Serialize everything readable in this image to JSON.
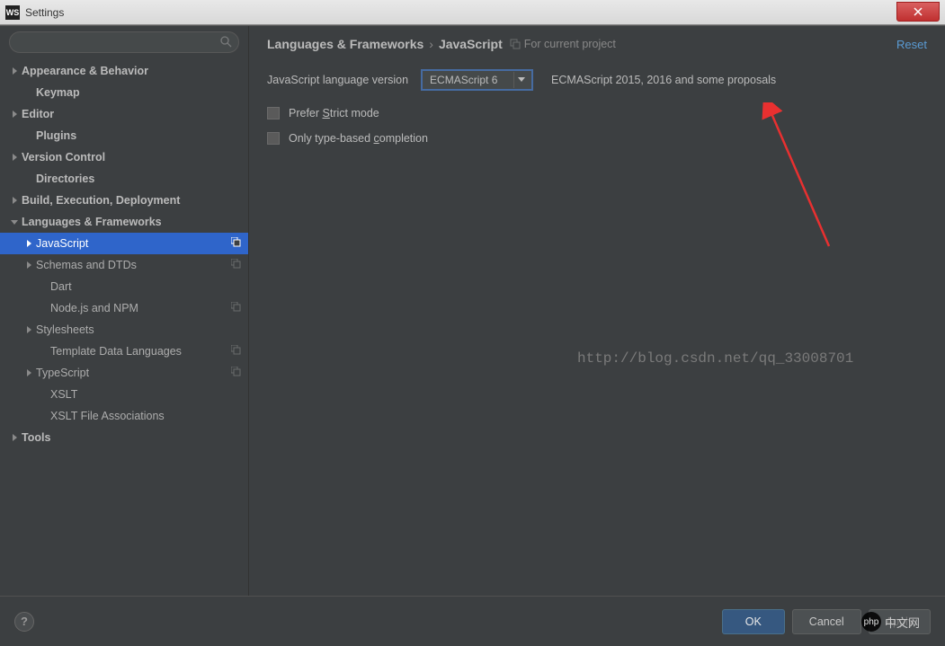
{
  "window": {
    "icon": "WS",
    "title": "Settings"
  },
  "search": {
    "placeholder": ""
  },
  "sidebar": [
    {
      "label": "Appearance & Behavior",
      "bold": true,
      "arrow": "right",
      "indent": 0
    },
    {
      "label": "Keymap",
      "bold": true,
      "arrow": "none",
      "indent": 0
    },
    {
      "label": "Editor",
      "bold": true,
      "arrow": "right",
      "indent": 0
    },
    {
      "label": "Plugins",
      "bold": true,
      "arrow": "none",
      "indent": 0
    },
    {
      "label": "Version Control",
      "bold": true,
      "arrow": "right",
      "indent": 0
    },
    {
      "label": "Directories",
      "bold": true,
      "arrow": "none",
      "indent": 0
    },
    {
      "label": "Build, Execution, Deployment",
      "bold": true,
      "arrow": "right",
      "indent": 0
    },
    {
      "label": "Languages & Frameworks",
      "bold": true,
      "arrow": "down",
      "indent": 0
    },
    {
      "label": "JavaScript",
      "bold": false,
      "arrow": "right",
      "indent": 1,
      "selected": true,
      "copy": true
    },
    {
      "label": "Schemas and DTDs",
      "bold": false,
      "arrow": "right",
      "indent": 1,
      "copy": true
    },
    {
      "label": "Dart",
      "bold": false,
      "arrow": "none",
      "indent": 1
    },
    {
      "label": "Node.js and NPM",
      "bold": false,
      "arrow": "none",
      "indent": 1,
      "copy": true
    },
    {
      "label": "Stylesheets",
      "bold": false,
      "arrow": "right",
      "indent": 1
    },
    {
      "label": "Template Data Languages",
      "bold": false,
      "arrow": "none",
      "indent": 1,
      "copy": true
    },
    {
      "label": "TypeScript",
      "bold": false,
      "arrow": "right",
      "indent": 1,
      "copy": true
    },
    {
      "label": "XSLT",
      "bold": false,
      "arrow": "none",
      "indent": 1
    },
    {
      "label": "XSLT File Associations",
      "bold": false,
      "arrow": "none",
      "indent": 1
    },
    {
      "label": "Tools",
      "bold": true,
      "arrow": "right",
      "indent": 0
    }
  ],
  "breadcrumb": {
    "seg1": "Languages & Frameworks",
    "seg2": "JavaScript",
    "scope": "For current project",
    "reset": "Reset"
  },
  "form": {
    "lang_label": "JavaScript language version",
    "lang_value": "ECMAScript 6",
    "lang_hint": "ECMAScript 2015, 2016 and some proposals",
    "cb1_pre": "Prefer ",
    "cb1_m": "S",
    "cb1_post": "trict mode",
    "cb2_pre": "Only type-based ",
    "cb2_m": "c",
    "cb2_post": "ompletion"
  },
  "watermark": "http://blog.csdn.net/qq_33008701",
  "footer": {
    "ok": "OK",
    "cancel": "Cancel",
    "apply": "Apply"
  },
  "bottom_wm": {
    "logo": "php",
    "text": "中文网"
  }
}
